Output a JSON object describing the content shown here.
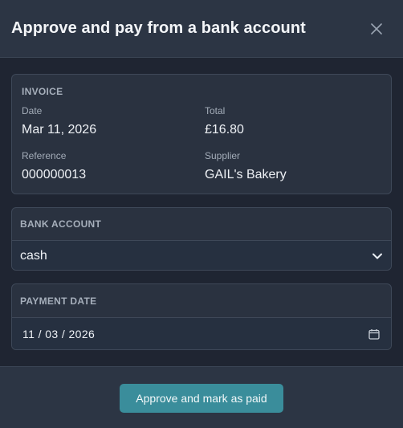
{
  "dialog": {
    "title": "Approve and pay from a bank account",
    "close_icon": "close-icon"
  },
  "invoice": {
    "section_label": "INVOICE",
    "date_label": "Date",
    "date_value": "Mar 11, 2026",
    "total_label": "Total",
    "total_value": "£16.80",
    "reference_label": "Reference",
    "reference_value": "000000013",
    "supplier_label": "Supplier",
    "supplier_value": "GAIL's Bakery"
  },
  "bank_account": {
    "section_label": "BANK ACCOUNT",
    "selected": "cash",
    "icon": "chevron-down-icon"
  },
  "payment_date": {
    "section_label": "PAYMENT DATE",
    "value": "11 / 03 / 2026",
    "icon": "calendar-icon"
  },
  "footer": {
    "primary_label": "Approve and mark as paid"
  },
  "colors": {
    "accent": "#3a8d9b",
    "background": "#1f2532",
    "header": "#2c3544"
  }
}
